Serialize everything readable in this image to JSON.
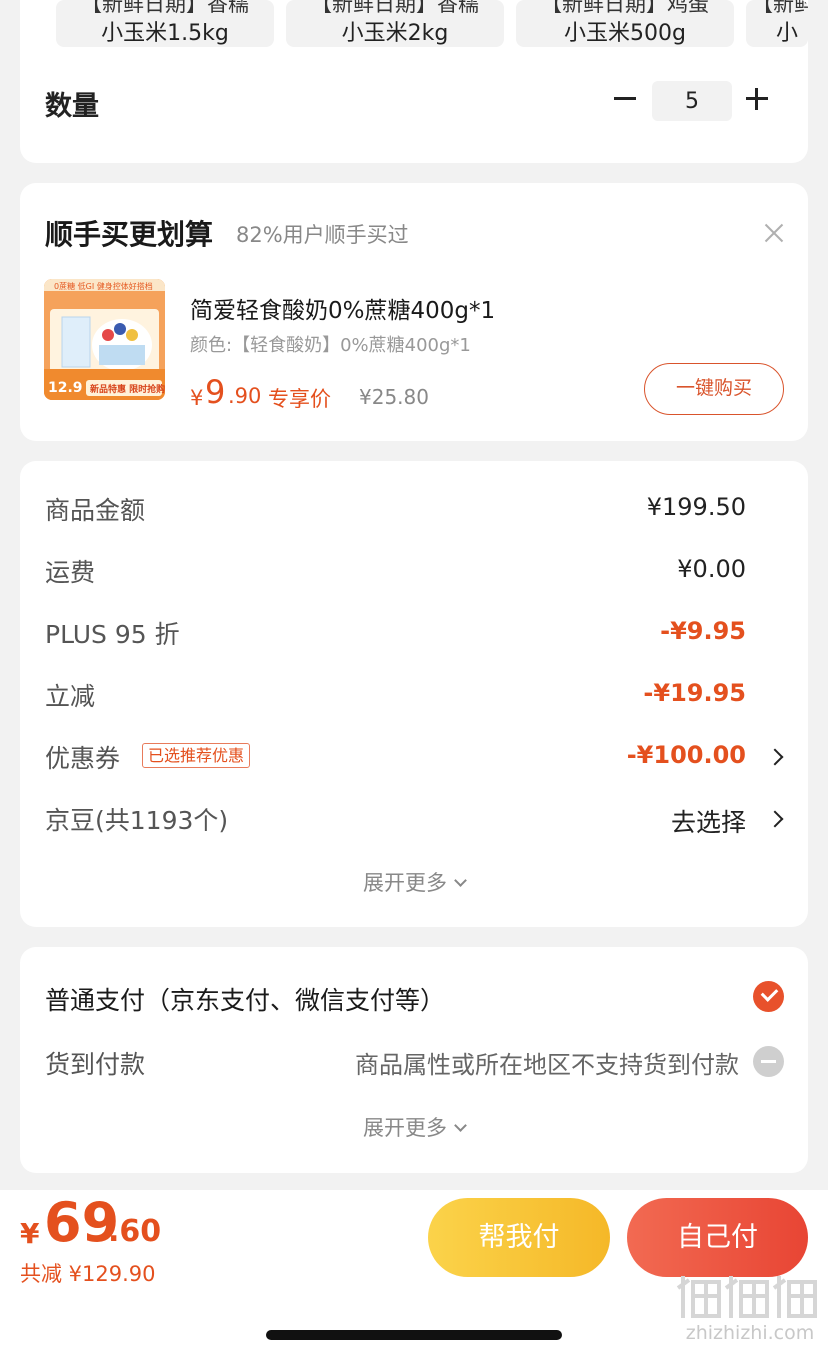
{
  "variants": [
    {
      "top": "【新鲜日期】香糯",
      "name": "小玉米1.5kg"
    },
    {
      "top": "【新鲜日期】香糯",
      "name": "小玉米2kg"
    },
    {
      "top": "【新鲜日期】鸡蛋",
      "name": "小玉米500g"
    },
    {
      "top": "【新鲜",
      "name": "小"
    }
  ],
  "quantity": {
    "label": "数量",
    "value": "5"
  },
  "addon": {
    "title": "顺手买更划算",
    "subtitle": "82%用户顺手买过",
    "product_name": "简爱轻食酸奶0%蔗糖400g*1",
    "spec": "颜色:【轻食酸奶】0%蔗糖400g*1",
    "price_symbol": "¥",
    "price_int": "9",
    "price_dec": ".90",
    "price_tag": "专享价",
    "original_price": "¥25.80",
    "buy_button": "一键购买",
    "image_texts": {
      "top_badge": "0蔗糖 低GI 健身控体好搭档",
      "price": "12.9",
      "banner": "新品特惠 限时抢购"
    }
  },
  "summary": {
    "rows": [
      {
        "label": "商品金额",
        "value": "¥199.50"
      },
      {
        "label": "运费",
        "value": "¥0.00"
      },
      {
        "label": "PLUS 95 折",
        "value": "-¥9.95"
      },
      {
        "label": "立减",
        "value": "-¥19.95"
      },
      {
        "label": "优惠券",
        "badge": "已选推荐优惠",
        "value": "-¥100.00"
      },
      {
        "label": "京豆(共1193个)",
        "value": "去选择"
      }
    ],
    "expand": "展开更多"
  },
  "payment": {
    "normal_label": "普通支付（京东支付、微信支付等）",
    "cod_label": "货到付款",
    "cod_note": "商品属性或所在地区不支持货到付款",
    "expand": "展开更多"
  },
  "bottom": {
    "total_symbol": "¥",
    "total_int": "69",
    "total_dec": ".60",
    "total_savings": "共减 ¥129.90",
    "help_pay": "帮我付",
    "self_pay": "自己付",
    "watermark": "zhizhizhi.com"
  },
  "colors": {
    "accent": "#e4501e",
    "help_button": "#f8c63a",
    "self_button": "#ed5542",
    "background": "#f2f2f2"
  }
}
